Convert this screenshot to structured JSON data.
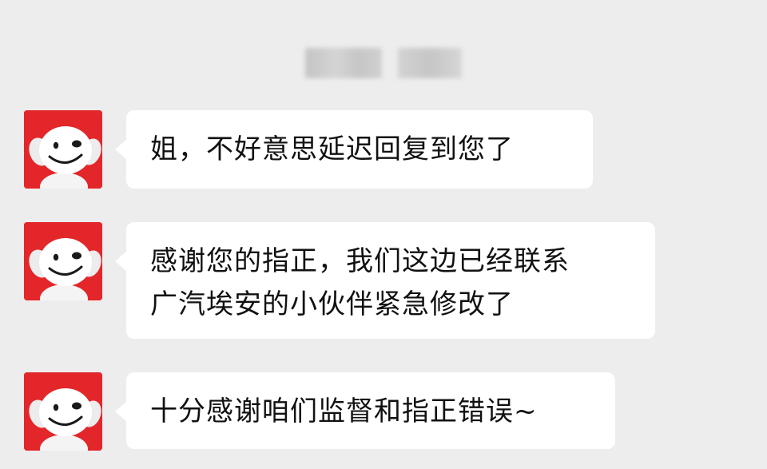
{
  "header": {
    "contact_name_blurred": ""
  },
  "messages": [
    {
      "sender": "other",
      "avatar_icon": "jd-dog-mascot-icon",
      "lines": [
        "姐，不好意思延迟回复到您了"
      ]
    },
    {
      "sender": "other",
      "avatar_icon": "jd-dog-mascot-icon",
      "lines": [
        "感谢您的指正，我们这边已经联系",
        "广汽埃安的小伙伴紧急修改了"
      ]
    },
    {
      "sender": "other",
      "avatar_icon": "jd-dog-mascot-icon",
      "lines": [
        "十分感谢咱们监督和指正错误~"
      ]
    }
  ],
  "colors": {
    "background": "#ededed",
    "bubble": "#ffffff",
    "avatar_bg": "#e3262a",
    "text": "#111111"
  }
}
